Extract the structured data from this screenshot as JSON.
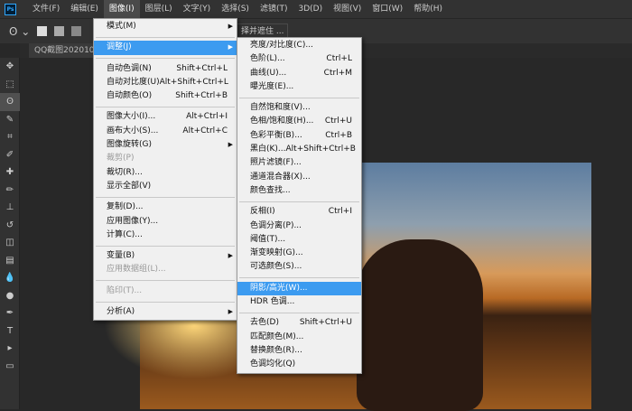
{
  "menubar": {
    "logo": "Ps",
    "items": [
      "文件(F)",
      "编辑(E)",
      "图像(I)",
      "图层(L)",
      "文字(Y)",
      "选择(S)",
      "滤镜(T)",
      "3D(D)",
      "视图(V)",
      "窗口(W)",
      "帮助(H)"
    ]
  },
  "options": {
    "select_mask": "择并遮住 ..."
  },
  "tab": {
    "label": "QQ截图2020102"
  },
  "image_menu": [
    [
      {
        "label": "模式(M)",
        "sub": true
      }
    ],
    [
      {
        "label": "调整(J)",
        "sub": true,
        "hl": true
      }
    ],
    [
      {
        "label": "自动色调(N)",
        "sc": "Shift+Ctrl+L"
      },
      {
        "label": "自动对比度(U)",
        "sc": "Alt+Shift+Ctrl+L"
      },
      {
        "label": "自动颜色(O)",
        "sc": "Shift+Ctrl+B"
      }
    ],
    [
      {
        "label": "图像大小(I)...",
        "sc": "Alt+Ctrl+I"
      },
      {
        "label": "画布大小(S)...",
        "sc": "Alt+Ctrl+C"
      },
      {
        "label": "图像旋转(G)",
        "sub": true
      },
      {
        "label": "裁剪(P)",
        "dis": true
      },
      {
        "label": "裁切(R)..."
      },
      {
        "label": "显示全部(V)"
      }
    ],
    [
      {
        "label": "复制(D)..."
      },
      {
        "label": "应用图像(Y)..."
      },
      {
        "label": "计算(C)..."
      }
    ],
    [
      {
        "label": "变量(B)",
        "sub": true
      },
      {
        "label": "应用数据组(L)...",
        "dis": true
      }
    ],
    [
      {
        "label": "陷印(T)...",
        "dis": true
      }
    ],
    [
      {
        "label": "分析(A)",
        "sub": true
      }
    ]
  ],
  "adjust_menu": [
    [
      {
        "label": "亮度/对比度(C)..."
      },
      {
        "label": "色阶(L)...",
        "sc": "Ctrl+L"
      },
      {
        "label": "曲线(U)...",
        "sc": "Ctrl+M"
      },
      {
        "label": "曝光度(E)..."
      }
    ],
    [
      {
        "label": "自然饱和度(V)..."
      },
      {
        "label": "色相/饱和度(H)...",
        "sc": "Ctrl+U"
      },
      {
        "label": "色彩平衡(B)...",
        "sc": "Ctrl+B"
      },
      {
        "label": "黑白(K)...",
        "sc": "Alt+Shift+Ctrl+B"
      },
      {
        "label": "照片滤镜(F)..."
      },
      {
        "label": "通道混合器(X)..."
      },
      {
        "label": "颜色查找..."
      }
    ],
    [
      {
        "label": "反相(I)",
        "sc": "Ctrl+I"
      },
      {
        "label": "色调分离(P)..."
      },
      {
        "label": "阈值(T)..."
      },
      {
        "label": "渐变映射(G)..."
      },
      {
        "label": "可选颜色(S)..."
      }
    ],
    [
      {
        "label": "阴影/高光(W)...",
        "hl": true
      },
      {
        "label": "HDR 色调..."
      }
    ],
    [
      {
        "label": "去色(D)",
        "sc": "Shift+Ctrl+U"
      },
      {
        "label": "匹配颜色(M)..."
      },
      {
        "label": "替换颜色(R)..."
      },
      {
        "label": "色调均化(Q)"
      }
    ]
  ],
  "tools": [
    "move-tool",
    "marquee-tool",
    "lasso-tool",
    "quick-select-tool",
    "crop-tool",
    "eyedropper-tool",
    "healing-tool",
    "brush-tool",
    "stamp-tool",
    "history-brush-tool",
    "eraser-tool",
    "gradient-tool",
    "blur-tool",
    "dodge-tool",
    "pen-tool",
    "text-tool",
    "path-select-tool",
    "shape-tool"
  ],
  "tool_glyphs": [
    "✥",
    "⬚",
    "ʘ",
    "✎",
    "⌗",
    "✐",
    "✚",
    "✏",
    "⊥",
    "↺",
    "◫",
    "▤",
    "💧",
    "●",
    "✒",
    "T",
    "▸",
    "▭"
  ]
}
